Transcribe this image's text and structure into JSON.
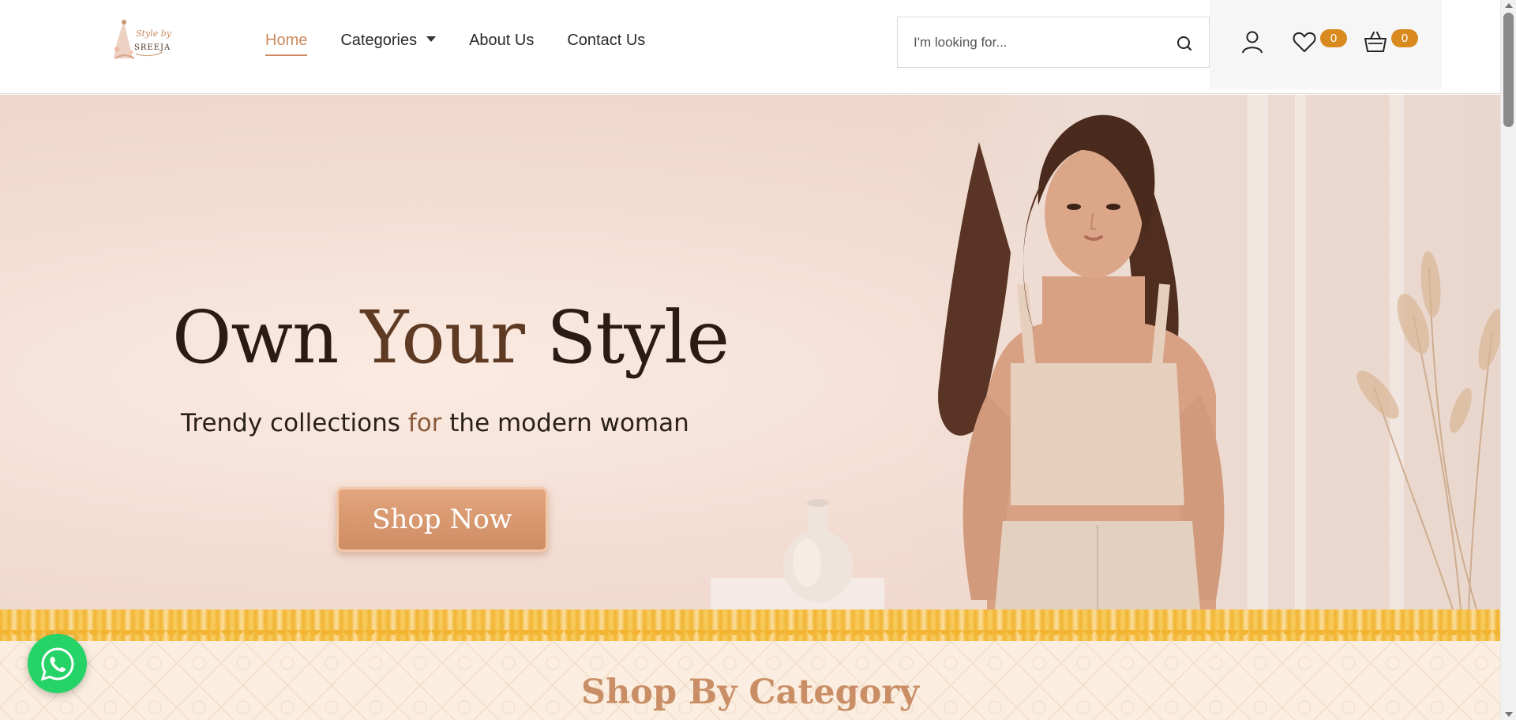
{
  "brand": {
    "logo_line1": "Style by",
    "logo_line2": "SREEJA"
  },
  "nav": {
    "items": [
      {
        "label": "Home",
        "active": true
      },
      {
        "label": "Categories",
        "dropdown": true
      },
      {
        "label": "About Us"
      },
      {
        "label": "Contact Us"
      }
    ]
  },
  "search": {
    "placeholder": "I'm looking for...",
    "icon": "search-icon"
  },
  "header_icons": {
    "account_icon": "user-icon",
    "wishlist_icon": "heart-icon",
    "wishlist_count": "0",
    "cart_icon": "basket-icon",
    "cart_count": "0"
  },
  "hero": {
    "title_part1": "Own ",
    "title_part2": "Your",
    "title_part3": " Style",
    "subtitle_part1": "Trendy collections ",
    "subtitle_part2": "for",
    "subtitle_part3": " the modern woman",
    "cta_label": "Shop Now"
  },
  "category_section": {
    "title": "Shop By Category"
  },
  "colors": {
    "accent": "#cc8b5f",
    "badge": "#d98a1f",
    "cta": "#d7956b",
    "whatsapp": "#25d366",
    "border_gold": "#f2b431"
  },
  "floating": {
    "whatsapp_icon": "whatsapp-icon"
  }
}
